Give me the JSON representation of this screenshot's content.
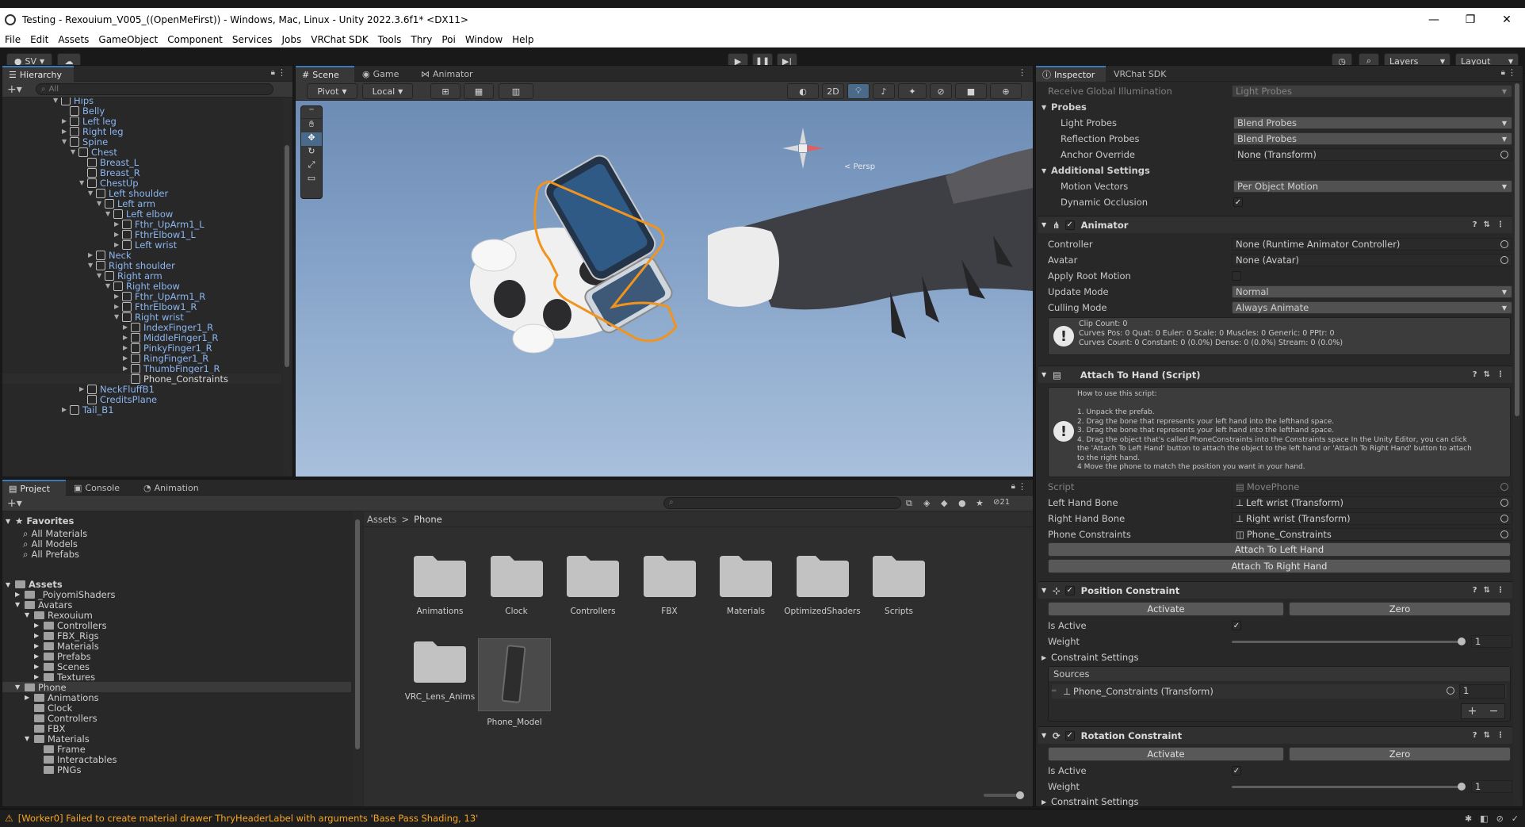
{
  "window": {
    "title": "Testing - Rexouium_V005_((OpenMeFirst)) - Windows, Mac, Linux - Unity 2022.3.6f1* <DX11>",
    "controls": [
      "—",
      "❐",
      "✕"
    ]
  },
  "menu": [
    "File",
    "Edit",
    "Assets",
    "GameObject",
    "Component",
    "Services",
    "Jobs",
    "VRChat SDK",
    "Tools",
    "Thry",
    "Poi",
    "Window",
    "Help"
  ],
  "toolbar": {
    "account": "SV",
    "layers": "Layers",
    "layout": "Layout"
  },
  "hierarchy": {
    "tab": "Hierarchy",
    "search_placeholder": "All",
    "rows": [
      {
        "label": "Hips",
        "indent": 6,
        "arrow": "▼"
      },
      {
        "label": "Belly",
        "indent": 7,
        "arrow": ""
      },
      {
        "label": "Left leg",
        "indent": 7,
        "arrow": "▶"
      },
      {
        "label": "Right leg",
        "indent": 7,
        "arrow": "▶"
      },
      {
        "label": "Spine",
        "indent": 7,
        "arrow": "▼"
      },
      {
        "label": "Chest",
        "indent": 8,
        "arrow": "▼"
      },
      {
        "label": "Breast_L",
        "indent": 9,
        "arrow": ""
      },
      {
        "label": "Breast_R",
        "indent": 9,
        "arrow": ""
      },
      {
        "label": "ChestUp",
        "indent": 9,
        "arrow": "▼"
      },
      {
        "label": "Left shoulder",
        "indent": 10,
        "arrow": "▼"
      },
      {
        "label": "Left arm",
        "indent": 11,
        "arrow": "▼"
      },
      {
        "label": "Left elbow",
        "indent": 12,
        "arrow": "▼"
      },
      {
        "label": "Fthr_UpArm1_L",
        "indent": 13,
        "arrow": "▶"
      },
      {
        "label": "FthrElbow1_L",
        "indent": 13,
        "arrow": "▶"
      },
      {
        "label": "Left wrist",
        "indent": 13,
        "arrow": "▶"
      },
      {
        "label": "Neck",
        "indent": 10,
        "arrow": "▶"
      },
      {
        "label": "Right shoulder",
        "indent": 10,
        "arrow": "▼"
      },
      {
        "label": "Right arm",
        "indent": 11,
        "arrow": "▼"
      },
      {
        "label": "Right elbow",
        "indent": 12,
        "arrow": "▼"
      },
      {
        "label": "Fthr_UpArm1_R",
        "indent": 13,
        "arrow": "▶"
      },
      {
        "label": "FthrElbow1_R",
        "indent": 13,
        "arrow": "▶"
      },
      {
        "label": "Right wrist",
        "indent": 13,
        "arrow": "▼"
      },
      {
        "label": "IndexFinger1_R",
        "indent": 14,
        "arrow": "▶"
      },
      {
        "label": "MiddleFinger1_R",
        "indent": 14,
        "arrow": "▶"
      },
      {
        "label": "PinkyFinger1_R",
        "indent": 14,
        "arrow": "▶"
      },
      {
        "label": "RingFinger1_R",
        "indent": 14,
        "arrow": "▶"
      },
      {
        "label": "ThumbFinger1_R",
        "indent": 14,
        "arrow": "▶"
      },
      {
        "label": "Phone_Constraints",
        "indent": 14,
        "arrow": "",
        "selected": true
      },
      {
        "label": "NeckFluffB1",
        "indent": 9,
        "arrow": "▶"
      },
      {
        "label": "CreditsPlane",
        "indent": 9,
        "arrow": ""
      },
      {
        "label": "Tail_B1",
        "indent": 7,
        "arrow": "▶"
      }
    ]
  },
  "scene": {
    "tabs": [
      "Scene",
      "Game",
      "Animator"
    ],
    "pivot": "Pivot",
    "local": "Local",
    "mode2d": "2D",
    "persp": "< Persp"
  },
  "project": {
    "tabs": [
      "Project",
      "Console",
      "Animation"
    ],
    "favorites_title": "Favorites",
    "favorites": [
      "All Materials",
      "All Models",
      "All Prefabs"
    ],
    "assets_title": "Assets",
    "tree": [
      {
        "label": "_PoiyomiShaders",
        "indent": 1,
        "arrow": "▶"
      },
      {
        "label": "Avatars",
        "indent": 1,
        "arrow": "▼"
      },
      {
        "label": "Rexouium",
        "indent": 2,
        "arrow": "▼"
      },
      {
        "label": "Controllers",
        "indent": 3,
        "arrow": "▶"
      },
      {
        "label": "FBX_Rigs",
        "indent": 3,
        "arrow": "▶"
      },
      {
        "label": "Materials",
        "indent": 3,
        "arrow": "▶"
      },
      {
        "label": "Prefabs",
        "indent": 3,
        "arrow": "▶"
      },
      {
        "label": "Scenes",
        "indent": 3,
        "arrow": "▶"
      },
      {
        "label": "Textures",
        "indent": 3,
        "arrow": "▶"
      },
      {
        "label": "Phone",
        "indent": 1,
        "arrow": "▼",
        "selected": true
      },
      {
        "label": "Animations",
        "indent": 2,
        "arrow": "▶"
      },
      {
        "label": "Clock",
        "indent": 2,
        "arrow": ""
      },
      {
        "label": "Controllers",
        "indent": 2,
        "arrow": ""
      },
      {
        "label": "FBX",
        "indent": 2,
        "arrow": ""
      },
      {
        "label": "Materials",
        "indent": 2,
        "arrow": "▼"
      },
      {
        "label": "Frame",
        "indent": 3,
        "arrow": ""
      },
      {
        "label": "Interactables",
        "indent": 3,
        "arrow": ""
      },
      {
        "label": "PNGs",
        "indent": 3,
        "arrow": ""
      }
    ],
    "breadcrumb": [
      "Assets",
      "Phone"
    ],
    "count": "21",
    "folders_row1": [
      "Animations",
      "Clock",
      "Controllers",
      "FBX",
      "Materials",
      "OptimizedShaders",
      "Scripts"
    ],
    "folders_row2": [
      "VRC_Lens_Anims"
    ],
    "model": "Phone_Model"
  },
  "inspector": {
    "tabs": [
      "Inspector",
      "VRChat SDK"
    ],
    "receive_gi": {
      "label": "Receive Global Illumination",
      "value": "Light Probes"
    },
    "probes": {
      "title": "Probes",
      "light_probes": {
        "label": "Light Probes",
        "value": "Blend Probes"
      },
      "reflection_probes": {
        "label": "Reflection Probes",
        "value": "Blend Probes"
      },
      "anchor": {
        "label": "Anchor Override",
        "value": "None (Transform)"
      }
    },
    "additional": {
      "title": "Additional Settings",
      "motion": {
        "label": "Motion Vectors",
        "value": "Per Object Motion"
      },
      "occlusion": {
        "label": "Dynamic Occlusion",
        "value": "✓"
      }
    },
    "animator": {
      "title": "Animator",
      "controller": {
        "label": "Controller",
        "value": "None (Runtime Animator Controller)"
      },
      "avatar": {
        "label": "Avatar",
        "value": "None (Avatar)"
      },
      "root_motion": {
        "label": "Apply Root Motion"
      },
      "update": {
        "label": "Update Mode",
        "value": "Normal"
      },
      "culling": {
        "label": "Culling Mode",
        "value": "Always Animate"
      },
      "info_lines": [
        "Clip Count: 0",
        "Curves Pos: 0 Quat: 0 Euler: 0 Scale: 0 Muscles: 0 Generic: 0 PPtr: 0",
        "Curves Count: 0 Constant: 0 (0.0%) Dense: 0 (0.0%) Stream: 0 (0.0%)"
      ]
    },
    "attach": {
      "title": "Attach To Hand (Script)",
      "help_lines": [
        "How to use this script:",
        "",
        "1. Unpack the prefab.",
        "2. Drag the bone that represents your left hand into the lefthand space.",
        "3. Drag the bone that represents your left hand into the lefthand space.",
        "4. Drag the object that's called PhoneConstraints into the Constraints space In the Unity Editor, you can click",
        "the 'Attach To Left Hand' button to attach the object to the left hand or 'Attach To Right Hand' button to attach",
        "to the right hand.",
        "4 Move the phone to match the position you want in your hand."
      ],
      "script": {
        "label": "Script",
        "value": "MovePhone"
      },
      "left": {
        "label": "Left Hand Bone",
        "value": "Left wrist (Transform)"
      },
      "right": {
        "label": "Right Hand Bone",
        "value": "Right wrist (Transform)"
      },
      "constraints": {
        "label": "Phone Constraints",
        "value": "Phone_Constraints"
      },
      "btn_left": "Attach To Left Hand",
      "btn_right": "Attach To Right Hand"
    },
    "position": {
      "title": "Position Constraint",
      "activate": "Activate",
      "zero": "Zero",
      "is_active": "Is Active",
      "weight": "Weight",
      "weight_value": "1",
      "settings": "Constraint Settings",
      "sources": "Sources",
      "source_item": "Phone_Constraints (Transform)",
      "source_weight": "1"
    },
    "rotation": {
      "title": "Rotation Constraint",
      "activate": "Activate",
      "zero": "Zero",
      "is_active": "Is Active",
      "weight": "Weight",
      "weight_value": "1",
      "settings": "Constraint Settings"
    }
  },
  "status": {
    "message": "[Worker0] Failed to create material drawer ThryHeaderLabel with arguments 'Base Pass Shading, 13'"
  }
}
